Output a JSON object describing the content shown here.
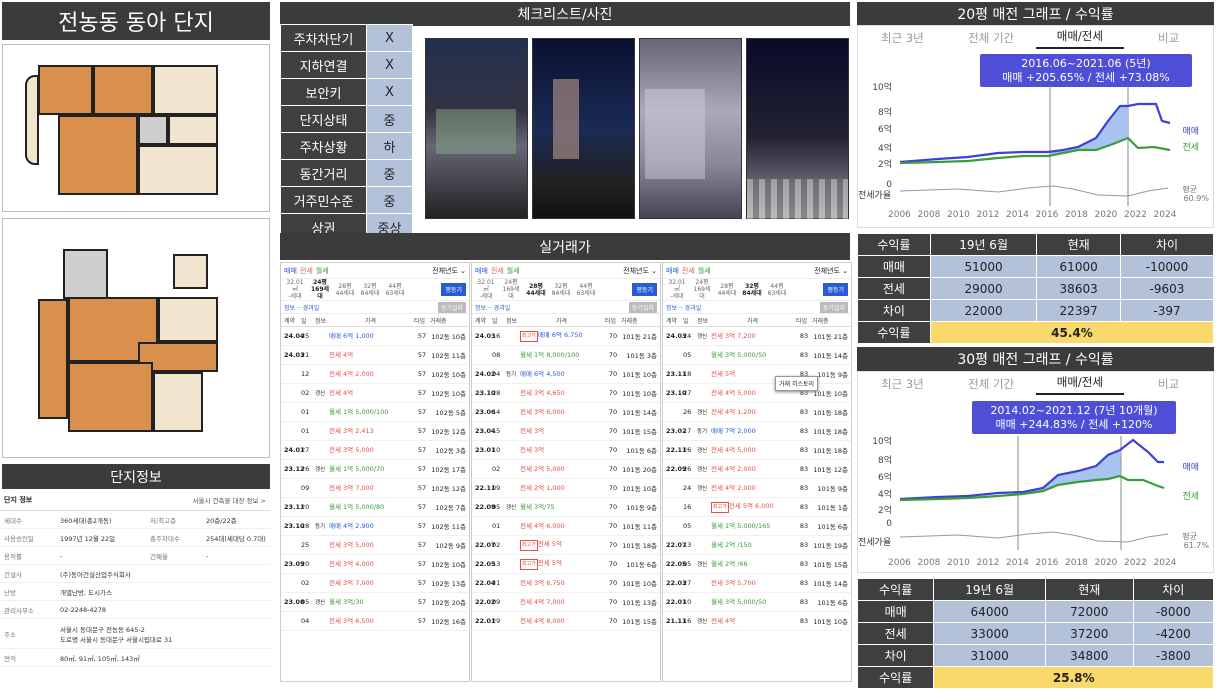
{
  "title": "전농동 동아 단지",
  "complex_info_header": "단지정보",
  "checklist_header": "체크리스트/사진",
  "trades_header": "실거래가",
  "checklist": [
    {
      "label": "주차차단기",
      "value": "X"
    },
    {
      "label": "지하연결",
      "value": "X"
    },
    {
      "label": "보안키",
      "value": "X"
    },
    {
      "label": "단지상태",
      "value": "중"
    },
    {
      "label": "주차상황",
      "value": "하"
    },
    {
      "label": "동간거리",
      "value": "중"
    },
    {
      "label": "거주민수준",
      "value": "중"
    },
    {
      "label": "상권",
      "value": "중상"
    }
  ],
  "complex_info": {
    "title": "단지 정보",
    "link": "서울시 건축물 대장 정보 >",
    "rows": [
      {
        "label": "세대수",
        "value": "360세대(총2개동)",
        "label2": "저/최고층",
        "value2": "20층/22층"
      },
      {
        "label": "사용승인일",
        "value": "1997년 12월 22일",
        "label2": "총주차대수",
        "value2": "254대(세대당 0.7대)"
      },
      {
        "label": "용적률",
        "value": "-",
        "label2": "건폐율",
        "value2": "-"
      },
      {
        "label": "건설사",
        "value": "(주)동아건설산업주식회사"
      },
      {
        "label": "난방",
        "value": "개별난방, 도시가스"
      },
      {
        "label": "관리사무소",
        "value": "02-2248-4278"
      },
      {
        "label": "주소",
        "value": "서울시 동대문구 전농동 645-2",
        "value_b": "도로명  서울시 동대문구 서울시립대로 31"
      },
      {
        "label": "면적",
        "value": "80㎡, 91㎡, 105㎡, 143㎡"
      }
    ]
  },
  "trades": {
    "tabs": [
      "매매",
      "전세",
      "월세"
    ],
    "sort": "전체년도 ⌄",
    "sizes": [
      {
        "pyeong": "32.01㎡",
        "units": "-세대"
      },
      {
        "pyeong": "24평",
        "units": "169세대"
      },
      {
        "pyeong": "28평",
        "units": "44세대"
      },
      {
        "pyeong": "32평",
        "units": "84세대"
      },
      {
        "pyeong": "44평",
        "units": "63세대"
      }
    ],
    "btn": "평등기",
    "sub": "정보 ·· 경과일",
    "sub_tag": "등기일자",
    "cols": [
      "계약",
      "일",
      "정보",
      "가격",
      "타입",
      "거래층"
    ],
    "panels": [
      {
        "active": 1,
        "rows": [
          {
            "d": "24.04",
            "dd": "25",
            "ic": "",
            "kind": "매매",
            "price": "6억 1,000",
            "ar": "57",
            "fl": "102동 10층"
          },
          {
            "d": "24.03",
            "dd": "21",
            "ic": "",
            "kind": "전세",
            "price": "4억",
            "ar": "57",
            "fl": "102동 11층"
          },
          {
            "d": "",
            "dd": "12",
            "ic": "",
            "kind": "전세",
            "price": "4억 2,000",
            "ar": "57",
            "fl": "102동 10층"
          },
          {
            "d": "",
            "dd": "02",
            "ic": "갱신",
            "kind": "전세",
            "price": "4억",
            "ar": "57",
            "fl": "102동 10층"
          },
          {
            "d": "",
            "dd": "01",
            "ic": "",
            "kind": "월세",
            "price": "1억 5,000/100",
            "ar": "57",
            "fl": "102동 5층"
          },
          {
            "d": "",
            "dd": "01",
            "ic": "",
            "kind": "전세",
            "price": "3억 2,413",
            "ar": "57",
            "fl": "102동 12층"
          },
          {
            "d": "24.01",
            "dd": "27",
            "ic": "",
            "kind": "전세",
            "price": "3억 5,000",
            "ar": "57",
            "fl": "102동 3층"
          },
          {
            "d": "23.12",
            "dd": "26",
            "ic": "갱신",
            "kind": "월세",
            "price": "1억 5,000/70",
            "ar": "57",
            "fl": "102동 17층"
          },
          {
            "d": "",
            "dd": "09",
            "ic": "",
            "kind": "전세",
            "price": "3억 7,000",
            "ar": "57",
            "fl": "102동 12층"
          },
          {
            "d": "23.11",
            "dd": "20",
            "ic": "",
            "kind": "월세",
            "price": "1억 5,000/80",
            "ar": "57",
            "fl": "102동 7층"
          },
          {
            "d": "23.10",
            "dd": "28",
            "ic": "등기",
            "kind": "매매",
            "price": "4억 2,900",
            "ar": "57",
            "fl": "102동 11층"
          },
          {
            "d": "",
            "dd": "25",
            "ic": "",
            "kind": "전세",
            "price": "3억 5,000",
            "ar": "57",
            "fl": "102동 9층"
          },
          {
            "d": "23.09",
            "dd": "20",
            "ic": "",
            "kind": "전세",
            "price": "3억 4,000",
            "ar": "57",
            "fl": "102동 10층"
          },
          {
            "d": "",
            "dd": "02",
            "ic": "",
            "kind": "전세",
            "price": "3억 7,000",
            "ar": "57",
            "fl": "102동 13층"
          },
          {
            "d": "23.08",
            "dd": "05",
            "ic": "갱신",
            "kind": "월세",
            "price": "3억/30",
            "ar": "57",
            "fl": "102동 20층"
          },
          {
            "d": "",
            "dd": "04",
            "ic": "",
            "kind": "전세",
            "price": "3억 6,500",
            "ar": "57",
            "fl": "102동 16층"
          }
        ]
      },
      {
        "active": 2,
        "rows": [
          {
            "d": "24.03",
            "dd": "16",
            "ic": "",
            "badge": "최고가",
            "kind": "매매",
            "price": "6억 6,750",
            "ar": "70",
            "fl": "101동 21층"
          },
          {
            "d": "",
            "dd": "08",
            "ic": "",
            "kind": "월세",
            "price": "1억 8,000/100",
            "ar": "70",
            "fl": "101동 3층"
          },
          {
            "d": "24.02",
            "dd": "04",
            "ic": "등기",
            "kind": "매매",
            "price": "6억 4,500",
            "ar": "70",
            "fl": "101동 10층"
          },
          {
            "d": "23.10",
            "dd": "28",
            "ic": "",
            "kind": "전세",
            "price": "3억 4,650",
            "ar": "70",
            "fl": "101동 10층"
          },
          {
            "d": "23.06",
            "dd": "14",
            "ic": "",
            "kind": "전세",
            "price": "3억 6,000",
            "ar": "70",
            "fl": "101동 14층"
          },
          {
            "d": "23.04",
            "dd": "15",
            "ic": "",
            "kind": "전세",
            "price": "3억",
            "ar": "70",
            "fl": "101동 15층"
          },
          {
            "d": "23.01",
            "dd": "10",
            "ic": "",
            "kind": "전세",
            "price": "3억",
            "ar": "70",
            "fl": "101동 6층"
          },
          {
            "d": "",
            "dd": "02",
            "ic": "",
            "kind": "전세",
            "price": "2억 5,000",
            "ar": "70",
            "fl": "101동 20층"
          },
          {
            "d": "22.11",
            "dd": "09",
            "ic": "",
            "kind": "전세",
            "price": "2억 1,000",
            "ar": "70",
            "fl": "101동 10층"
          },
          {
            "d": "22.09",
            "dd": "05",
            "ic": "갱신",
            "kind": "월세",
            "price": "3억/75",
            "ar": "70",
            "fl": "101동 9층"
          },
          {
            "d": "",
            "dd": "01",
            "ic": "",
            "kind": "전세",
            "price": "4억 6,000",
            "ar": "70",
            "fl": "101동 11층"
          },
          {
            "d": "22.07",
            "dd": "02",
            "ic": "",
            "badge": "최고가",
            "kind": "전세",
            "price": "5억",
            "ar": "70",
            "fl": "101동 18층"
          },
          {
            "d": "22.05",
            "dd": "13",
            "ic": "",
            "badge": "최고가",
            "kind": "전세",
            "price": "5억",
            "ar": "70",
            "fl": "101동 6층"
          },
          {
            "d": "22.04",
            "dd": "21",
            "ic": "",
            "kind": "전세",
            "price": "3억 6,750",
            "ar": "70",
            "fl": "101동 10층"
          },
          {
            "d": "22.02",
            "dd": "09",
            "ic": "",
            "kind": "전세",
            "price": "4억 7,000",
            "ar": "70",
            "fl": "101동 13층"
          },
          {
            "d": "22.01",
            "dd": "29",
            "ic": "",
            "kind": "전세",
            "price": "4억 8,000",
            "ar": "70",
            "fl": "101동 15층"
          }
        ]
      },
      {
        "active": 3,
        "popup": "거래 히스토리",
        "rows": [
          {
            "d": "24.03",
            "dd": "24",
            "ic": "갱신",
            "kind": "전세",
            "price": "3억 7,200",
            "ar": "83",
            "fl": "101동 21층"
          },
          {
            "d": "",
            "dd": "05",
            "ic": "",
            "kind": "월세",
            "price": "3억 5,000/50",
            "ar": "83",
            "fl": "101동 14층"
          },
          {
            "d": "23.11",
            "dd": "18",
            "ic": "",
            "kind": "전세",
            "price": "5억",
            "ar": "83",
            "fl": "101동 9층"
          },
          {
            "d": "23.10",
            "dd": "27",
            "ic": "",
            "kind": "전세",
            "price": "4억 5,000",
            "ar": "83",
            "fl": "101동 10층"
          },
          {
            "d": "",
            "dd": "26",
            "ic": "갱신",
            "kind": "전세",
            "price": "4억 1,200",
            "ar": "83",
            "fl": "101동 18층"
          },
          {
            "d": "23.02",
            "dd": "17",
            "ic": "등기",
            "kind": "매매",
            "price": "7억 2,000",
            "ar": "83",
            "fl": "101동 18층"
          },
          {
            "d": "22.11",
            "dd": "26",
            "ic": "갱신",
            "kind": "전세",
            "price": "4억 5,000",
            "ar": "83",
            "fl": "101동 18층"
          },
          {
            "d": "22.09",
            "dd": "26",
            "ic": "갱신",
            "kind": "전세",
            "price": "4억 2,000",
            "ar": "83",
            "fl": "101동 12층"
          },
          {
            "d": "",
            "dd": "24",
            "ic": "갱신",
            "kind": "전세",
            "price": "4억 2,000",
            "ar": "83",
            "fl": "101동 9층"
          },
          {
            "d": "",
            "dd": "16",
            "ic": "",
            "badge": "최고가",
            "kind": "전세",
            "price": "5억 6,000",
            "ar": "83",
            "fl": "101동 1층"
          },
          {
            "d": "",
            "dd": "05",
            "ic": "",
            "kind": "월세",
            "price": "1억 5,000/165",
            "ar": "83",
            "fl": "101동 6층"
          },
          {
            "d": "22.07",
            "dd": "13",
            "ic": "",
            "kind": "월세",
            "price": "2억 /150",
            "ar": "83",
            "fl": "101동 19층"
          },
          {
            "d": "22.05",
            "dd": "05",
            "ic": "갱신",
            "kind": "월세",
            "price": "2억 /66",
            "ar": "83",
            "fl": "101동 15층"
          },
          {
            "d": "22.03",
            "dd": "27",
            "ic": "",
            "kind": "전세",
            "price": "3억 5,700",
            "ar": "83",
            "fl": "101동 14층"
          },
          {
            "d": "22.01",
            "dd": "10",
            "ic": "",
            "kind": "월세",
            "price": "3억 5,000/50",
            "ar": "83",
            "fl": "101동 6층"
          },
          {
            "d": "21.11",
            "dd": "16",
            "ic": "갱신",
            "kind": "전세",
            "price": "4억",
            "ar": "83",
            "fl": "101동 10층"
          }
        ]
      }
    ]
  },
  "graph20": {
    "header": "20평 매전 그래프 / 수익률",
    "tabs": [
      "최근 3년",
      "전체 기간",
      "매매/전세",
      "비교"
    ],
    "tip1": "2016.06~2021.06 (5년)",
    "tip2": "매매 +205.65% / 전세 +73.08%",
    "legend_sale": "매매",
    "legend_jeonse": "전세",
    "gap_label": "전세가율",
    "avg": "평균",
    "avg_val": "60.9%",
    "yticks": [
      "10억",
      "8억",
      "6억",
      "4억",
      "2억",
      "0"
    ],
    "xticks": [
      "2006",
      "2008",
      "2010",
      "2012",
      "2014",
      "2016",
      "2018",
      "2020",
      "2022",
      "2024"
    ]
  },
  "table20": {
    "head": [
      "수익률",
      "19년 6월",
      "현재",
      "차이"
    ],
    "rows": [
      [
        "매매",
        "51000",
        "61000",
        "-10000"
      ],
      [
        "전세",
        "29000",
        "38603",
        "-9603"
      ],
      [
        "차이",
        "22000",
        "22397",
        "-397"
      ]
    ],
    "total_label": "수익률",
    "total": "45.4%"
  },
  "graph30": {
    "header": "30평 매전 그래프 / 수익률",
    "tabs": [
      "최근 3년",
      "전체 기간",
      "매매/전세",
      "비교"
    ],
    "tip1": "2014.02~2021.12 (7년 10개월)",
    "tip2": "매매 +244.83% / 전세 +120%",
    "legend_sale": "매매",
    "legend_jeonse": "전세",
    "gap_label": "전세가율",
    "avg": "평균",
    "avg_val": "61.7%",
    "yticks": [
      "10억",
      "8억",
      "6억",
      "4억",
      "2억",
      "0"
    ],
    "xticks": [
      "2006",
      "2008",
      "2010",
      "2012",
      "2014",
      "2016",
      "2018",
      "2020",
      "2022",
      "2024"
    ]
  },
  "table30": {
    "head": [
      "수익률",
      "19년 6월",
      "현재",
      "차이"
    ],
    "rows": [
      [
        "매매",
        "64000",
        "72000",
        "-8000"
      ],
      [
        "전세",
        "33000",
        "37200",
        "-4200"
      ],
      [
        "차이",
        "31000",
        "34800",
        "-3800"
      ]
    ],
    "total_label": "수익률",
    "total": "25.8%"
  },
  "colors": {
    "sale": "#4040d8",
    "jeonse": "#3a9c3a",
    "header": "#3b3b3b",
    "cell": "#b4c2d9",
    "highlight": "#f9d96b"
  }
}
